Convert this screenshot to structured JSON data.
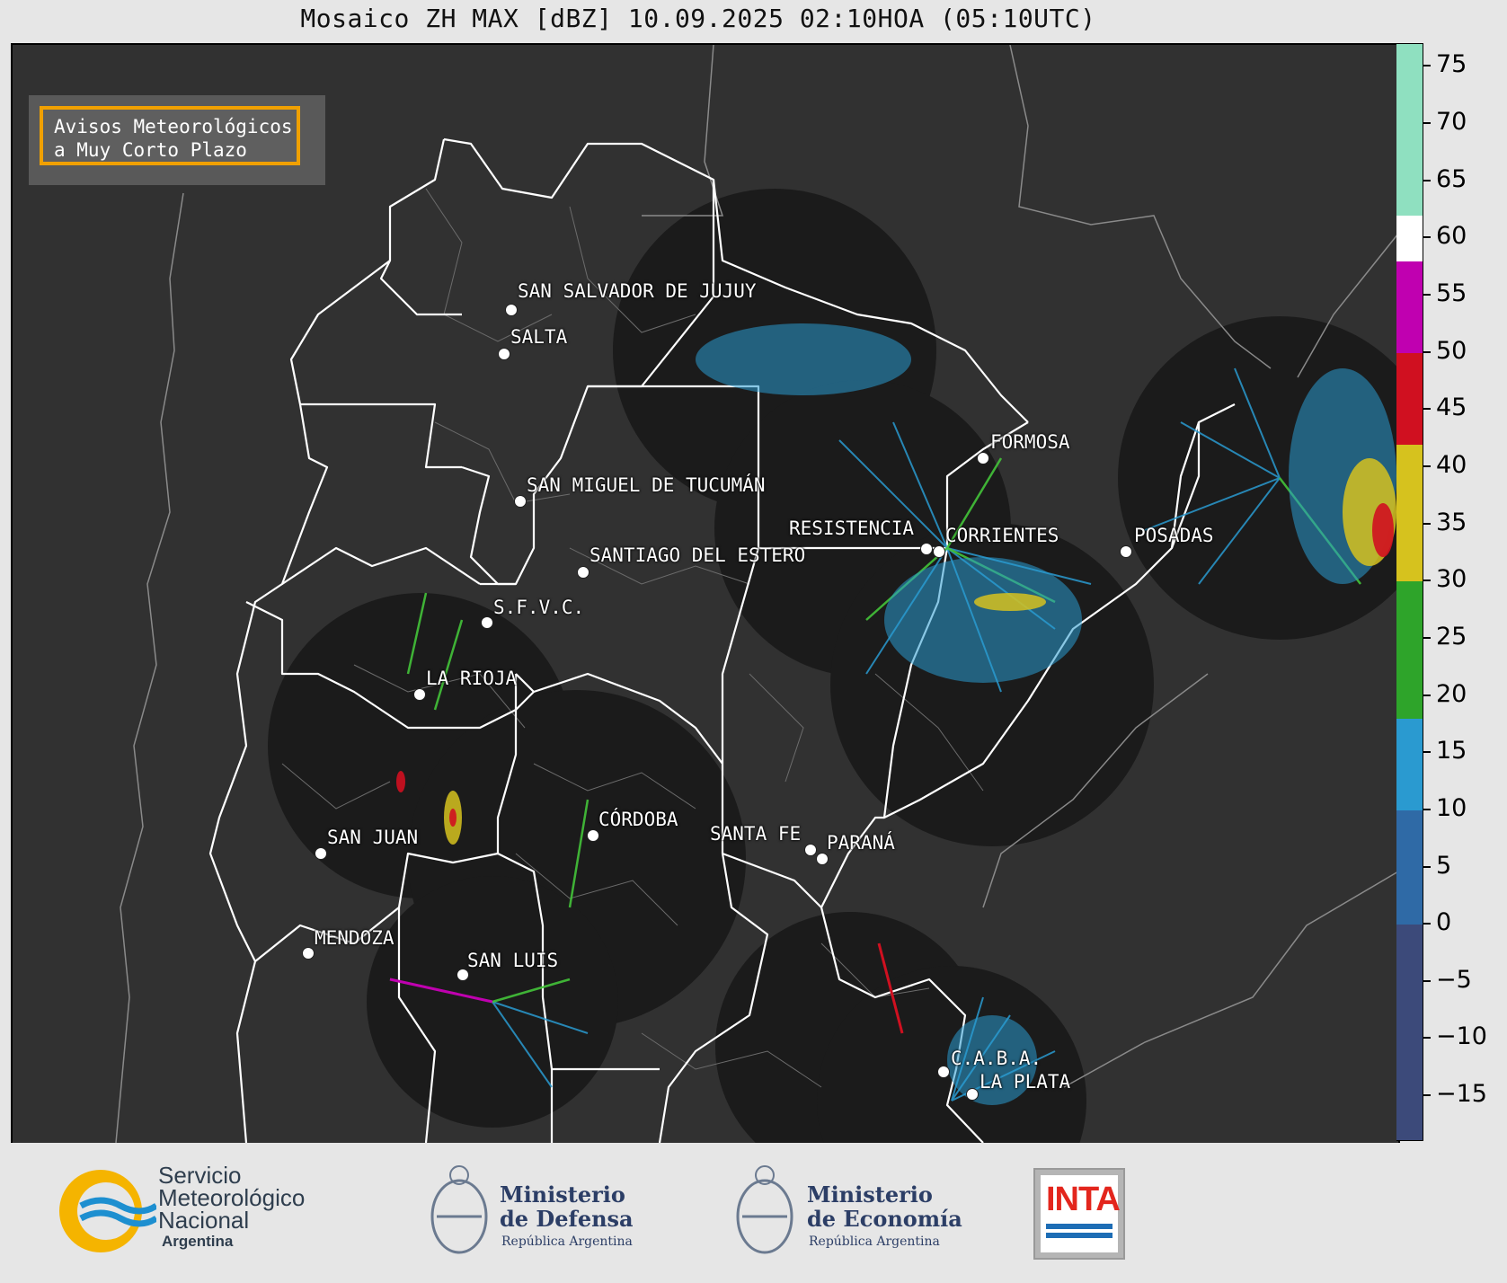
{
  "title": "Mosaico ZH MAX [dBZ] 10.09.2025 02:10HOA (05:10UTC)",
  "warning_box": {
    "text": "Avisos Meteorológicos\na Muy Corto Plazo",
    "border_color": "#f0a000"
  },
  "cities": [
    {
      "name": "SAN SALVADOR DE JUJUY"
    },
    {
      "name": "SALTA"
    },
    {
      "name": "FORMOSA"
    },
    {
      "name": "SAN MIGUEL DE TUCUMÁN"
    },
    {
      "name": "RESISTENCIA"
    },
    {
      "name": "CORRIENTES"
    },
    {
      "name": "POSADAS"
    },
    {
      "name": "SANTIAGO DEL ESTERO"
    },
    {
      "name": "S.F.V.C."
    },
    {
      "name": "LA RIOJA"
    },
    {
      "name": "CÓRDOBA"
    },
    {
      "name": "SANTA FE"
    },
    {
      "name": "PARANÁ"
    },
    {
      "name": "SAN JUAN"
    },
    {
      "name": "MENDOZA"
    },
    {
      "name": "SAN LUIS"
    },
    {
      "name": "C.A.B.A."
    },
    {
      "name": "LA PLATA"
    }
  ],
  "colorbar": {
    "unit": "dBZ",
    "range": [
      -19,
      77
    ],
    "ticks": [
      "75",
      "70",
      "65",
      "60",
      "55",
      "50",
      "45",
      "40",
      "35",
      "30",
      "25",
      "20",
      "15",
      "10",
      "5",
      "0",
      "−5",
      "−10",
      "−15"
    ],
    "tick_values": [
      75,
      70,
      65,
      60,
      55,
      50,
      45,
      40,
      35,
      30,
      25,
      20,
      15,
      10,
      5,
      0,
      -5,
      -10,
      -15
    ],
    "bands": [
      {
        "from": -19,
        "to": 0,
        "color": "#3c4a7a"
      },
      {
        "from": 0,
        "to": 10,
        "color": "#2f6aa6"
      },
      {
        "from": 10,
        "to": 18,
        "color": "#2a9ad0"
      },
      {
        "from": 18,
        "to": 30,
        "color": "#2ea42a"
      },
      {
        "from": 30,
        "to": 42,
        "color": "#d6c21e"
      },
      {
        "from": 42,
        "to": 50,
        "color": "#d01020"
      },
      {
        "from": 50,
        "to": 58,
        "color": "#c000b0"
      },
      {
        "from": 58,
        "to": 62,
        "color": "#ffffff"
      },
      {
        "from": 62,
        "to": 77,
        "color": "#8fe0c0"
      }
    ]
  },
  "footer": {
    "smn": {
      "lines": "Servicio\nMeteorológico\nNacional",
      "country": "Argentina"
    },
    "defensa": {
      "lines": "Ministerio\nde Defensa",
      "sub": "República Argentina"
    },
    "economia": {
      "lines": "Ministerio\nde Economía",
      "sub": "República Argentina"
    },
    "inta": {
      "text": "INTA"
    }
  },
  "colors": {
    "map_background": "#313131",
    "radar_disc": "#1b1b1b",
    "province_border": "#ffffff",
    "country_border": "#8a8a8a"
  }
}
